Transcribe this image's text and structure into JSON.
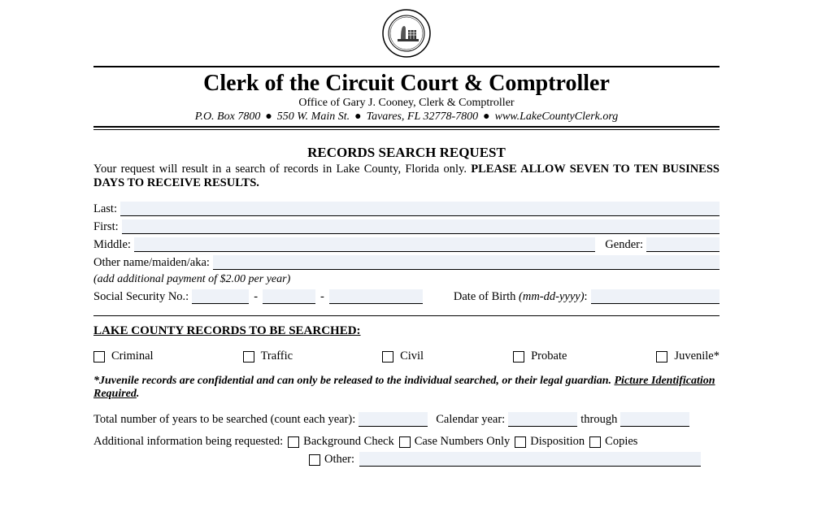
{
  "header": {
    "title": "Clerk of the Circuit Court & Comptroller",
    "subtitle": "Office of Gary J. Cooney, Clerk & Comptroller",
    "po_box": "P.O. Box 7800",
    "street": "550 W. Main St.",
    "city": "Tavares, FL 32778-7800",
    "website": "www.LakeCountyClerk.org"
  },
  "form": {
    "title": "RECORDS SEARCH REQUEST",
    "intro_prefix": "Your request will result in a search of records in Lake County, Florida only. ",
    "intro_bold": "PLEASE ALLOW SEVEN TO TEN BUSINESS DAYS TO RECEIVE RESULTS.",
    "labels": {
      "last": "Last:",
      "first": "First:",
      "middle": "Middle:",
      "gender": "Gender:",
      "aka": "Other name/maiden/aka:",
      "aka_note": "(add additional payment of $2.00 per year)",
      "ssn": "Social Security No.:",
      "dob": "Date of Birth (mm-dd-yyyy):"
    },
    "records_heading": "LAKE COUNTY RECORDS TO BE SEARCHED:",
    "record_types": [
      "Criminal",
      "Traffic",
      "Civil",
      "Probate",
      "Juvenile*"
    ],
    "disclaimer_main": "*Juvenile records are confidential and can only be released to the individual searched, or their legal guardian.",
    "disclaimer_u1": "Picture Identification Required",
    "years_label": "Total number of years to be searched (count each year):",
    "calendar_label": "Calendar year:",
    "through": "through",
    "addl_label": "Additional information being requested:",
    "addl_options": [
      "Background Check",
      "Case Numbers Only",
      "Disposition",
      "Copies"
    ],
    "other_label": "Other:"
  }
}
